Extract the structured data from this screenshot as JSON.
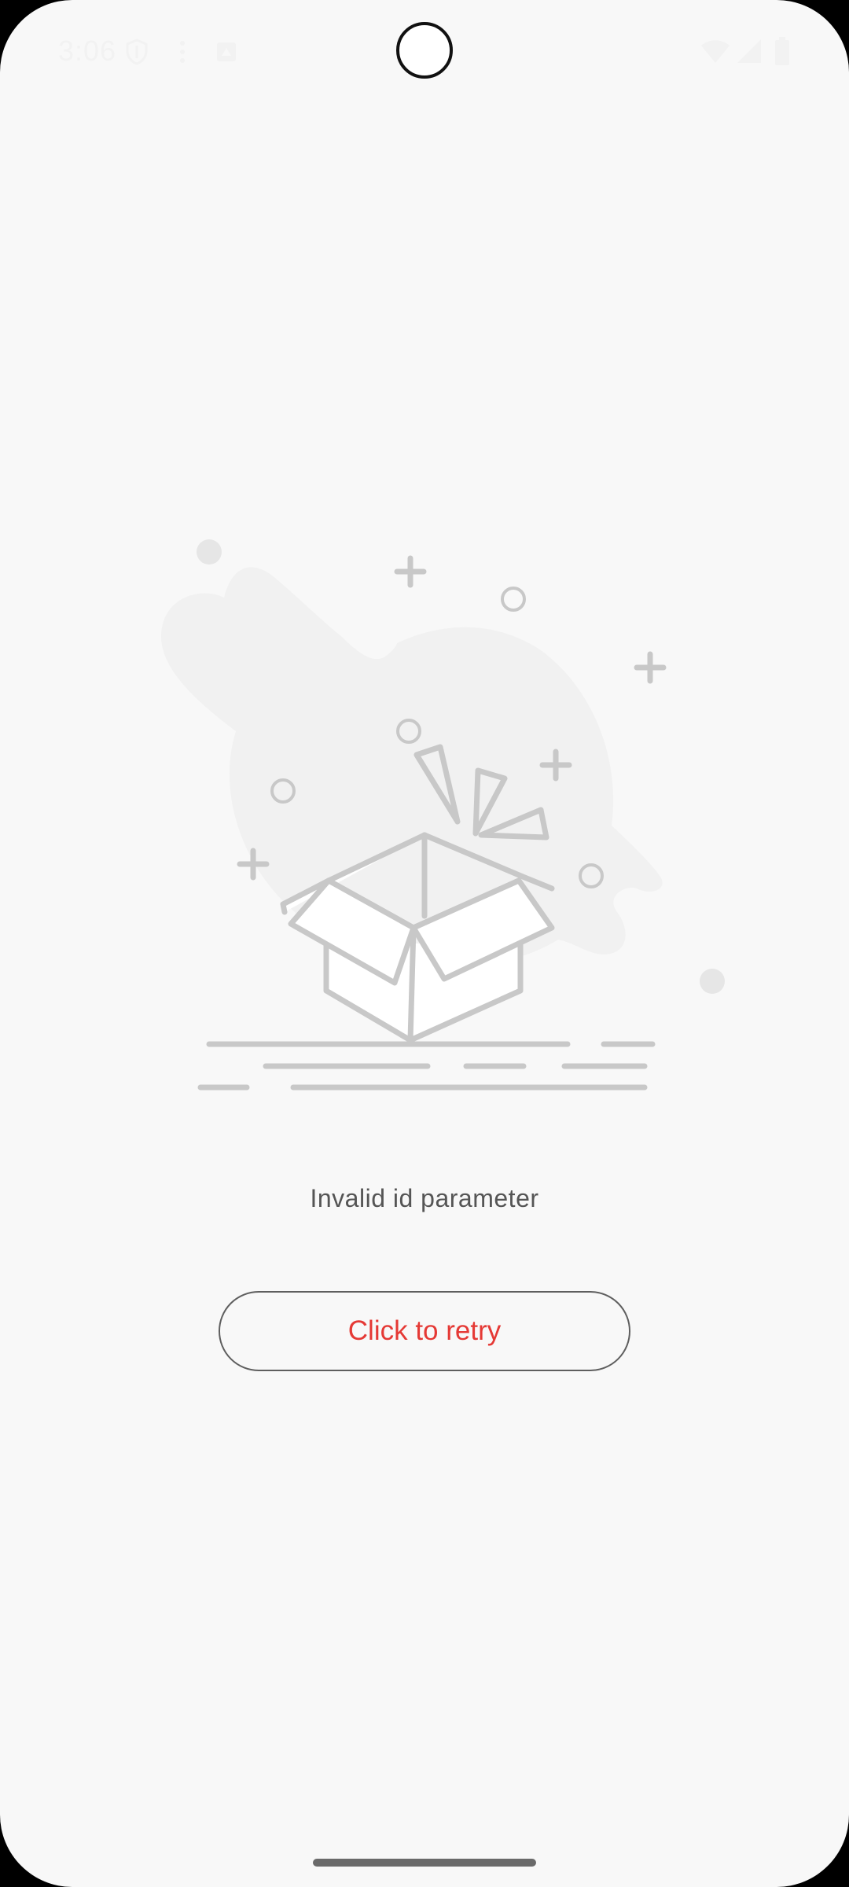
{
  "status_bar": {
    "time": "3:06",
    "left_icons": [
      "shield-icon",
      "more-vert-icon",
      "notification-square-icon"
    ],
    "right_icons": [
      "wifi-icon",
      "signal-icon",
      "battery-icon"
    ]
  },
  "empty_state": {
    "illustration": "empty-box-icon",
    "message": "Invalid id parameter"
  },
  "retry": {
    "label": "Click to retry",
    "label_color": "#e53935"
  },
  "colors": {
    "background": "#f8f8f8",
    "illustration_stroke": "#c8c8c8",
    "illustration_blob": "#f1f1f1",
    "message_text": "#555555"
  }
}
